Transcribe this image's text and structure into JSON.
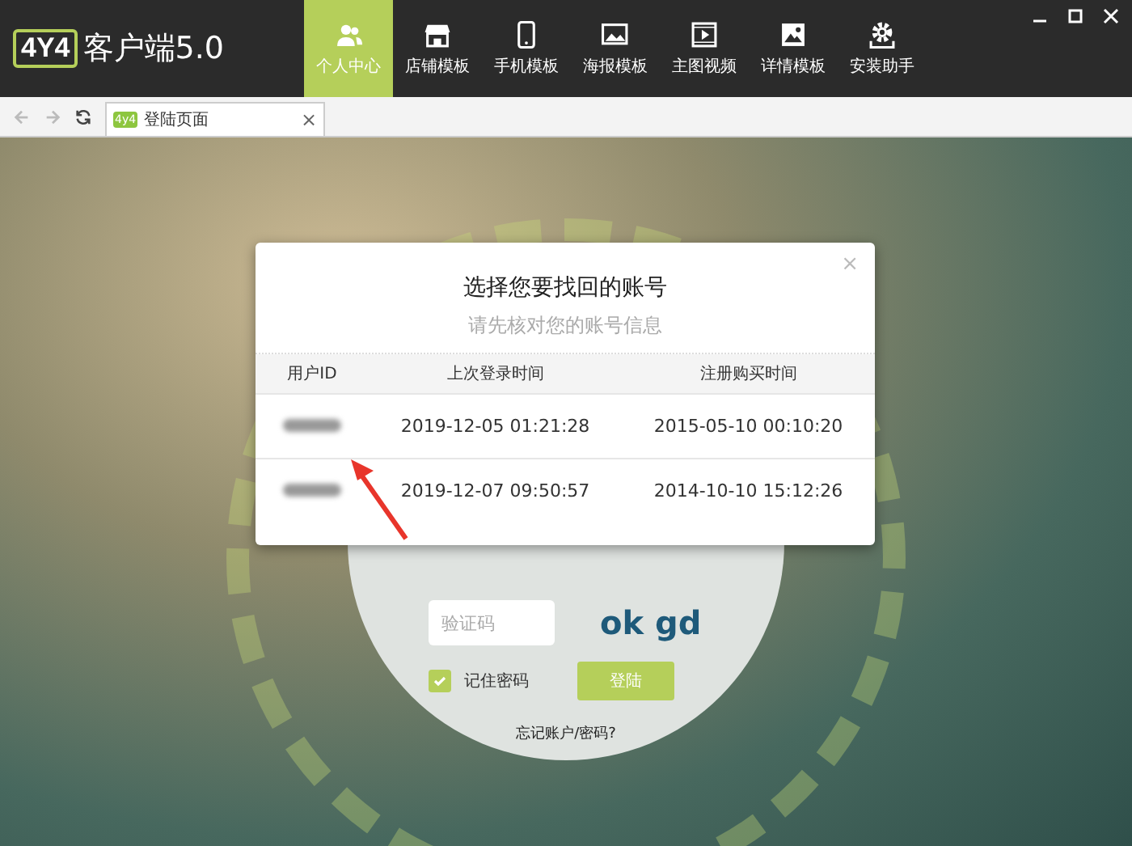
{
  "app": {
    "logo_mark": "4Y4",
    "logo_text": "客户端5.0"
  },
  "nav": [
    {
      "label": "个人中心",
      "kind": "users",
      "selected": true
    },
    {
      "label": "店铺模板",
      "kind": "shop",
      "selected": false
    },
    {
      "label": "手机模板",
      "kind": "phone",
      "selected": false
    },
    {
      "label": "海报模板",
      "kind": "image",
      "selected": false
    },
    {
      "label": "主图视频",
      "kind": "film",
      "selected": false
    },
    {
      "label": "详情模板",
      "kind": "picture",
      "selected": false
    },
    {
      "label": "安装助手",
      "kind": "gear",
      "selected": false
    }
  ],
  "browser_tab": {
    "badge": "4y4",
    "title": "登陆页面",
    "close": "×"
  },
  "login": {
    "captcha_placeholder": "验证码",
    "captcha_text": "ok gd",
    "remember": {
      "label": "记住密码",
      "checked": true
    },
    "login_button": "登陆",
    "forgot_link": "忘记账户/密码?"
  },
  "dialog": {
    "close": "×",
    "title": "选择您要找回的账号",
    "subtitle": "请先核对您的账号信息",
    "columns": [
      "用户ID",
      "上次登录时间",
      "注册购买时间"
    ],
    "rows": [
      {
        "last_login": "2019-12-05 01:21:28",
        "registered": "2015-05-10 00:10:20"
      },
      {
        "last_login": "2019-12-07 09:50:57",
        "registered": "2014-10-10 15:12:26"
      }
    ]
  }
}
